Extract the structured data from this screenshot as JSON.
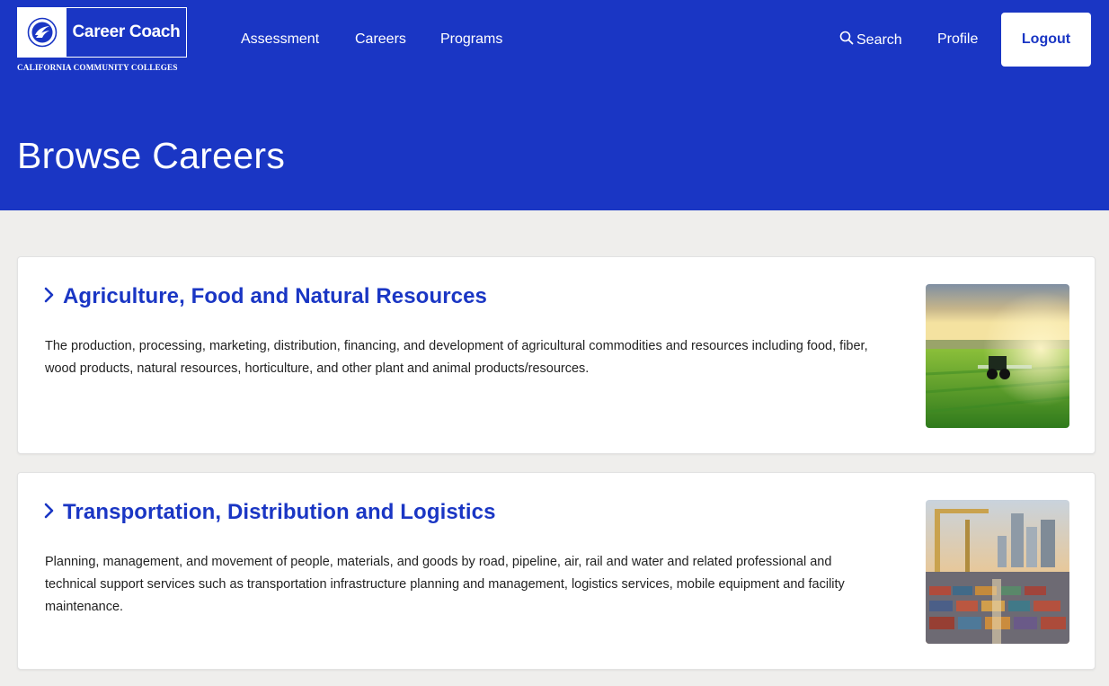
{
  "brand": {
    "title": "Career Coach",
    "subtitle": "CALIFORNIA COMMUNITY COLLEGES",
    "primary_color": "#1a36c4"
  },
  "nav": {
    "assessment": "Assessment",
    "careers": "Careers",
    "programs": "Programs",
    "search": "Search",
    "search_icon": "search-icon",
    "profile": "Profile",
    "logout": "Logout"
  },
  "page": {
    "title": "Browse Careers"
  },
  "categories": [
    {
      "title": "Agriculture, Food and Natural Resources",
      "description": "The production, processing, marketing, distribution, financing, and development of agricultural commodities and resources including food, fiber, wood products, natural resources, horticulture, and other plant and animal products/resources.",
      "icon": "chevron-right-icon"
    },
    {
      "title": "Transportation, Distribution and Logistics",
      "description": "Planning, management, and movement of people, materials, and goods by road, pipeline, air, rail and water and related professional and technical support services such as transportation infrastructure planning and management, logistics services, mobile equipment and facility maintenance.",
      "icon": "chevron-right-icon"
    }
  ]
}
